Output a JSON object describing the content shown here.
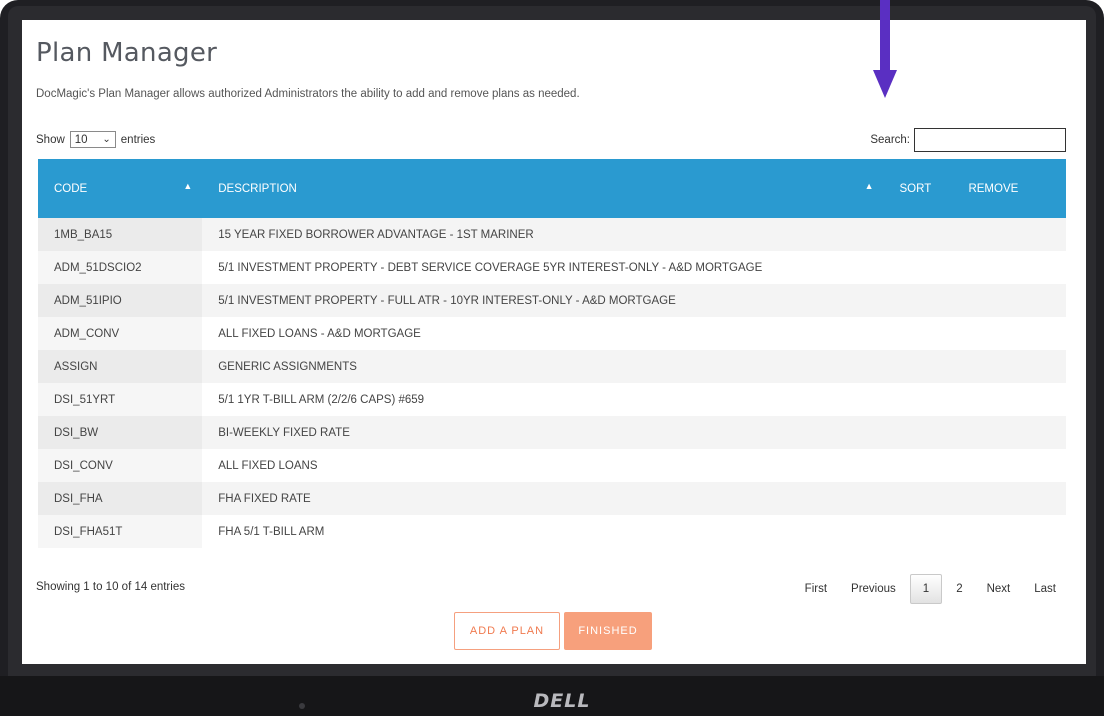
{
  "page": {
    "title": "Plan Manager",
    "description": "DocMagic's Plan Manager allows authorized Administrators the ability to add and remove plans as needed."
  },
  "length_menu": {
    "show_label": "Show",
    "selected": "10",
    "entries_label": "entries"
  },
  "search": {
    "label": "Search:",
    "value": ""
  },
  "table": {
    "columns": [
      "CODE",
      "DESCRIPTION",
      "SORT",
      "REMOVE"
    ],
    "rows": [
      {
        "code": "1MB_BA15",
        "description": "15 YEAR FIXED BORROWER ADVANTAGE - 1ST MARINER"
      },
      {
        "code": "ADM_51DSCIO2",
        "description": "5/1 INVESTMENT PROPERTY - DEBT SERVICE COVERAGE 5YR INTEREST-ONLY - A&D MORTGAGE"
      },
      {
        "code": "ADM_51IPIO",
        "description": "5/1 INVESTMENT PROPERTY - FULL ATR - 10YR INTEREST-ONLY - A&D MORTGAGE"
      },
      {
        "code": "ADM_CONV",
        "description": "ALL FIXED LOANS - A&D MORTGAGE"
      },
      {
        "code": "ASSIGN",
        "description": "GENERIC ASSIGNMENTS"
      },
      {
        "code": "DSI_51YRT",
        "description": "5/1 1YR T-BILL ARM (2/2/6 CAPS) #659"
      },
      {
        "code": "DSI_BW",
        "description": "BI-WEEKLY FIXED RATE"
      },
      {
        "code": "DSI_CONV",
        "description": "ALL FIXED LOANS"
      },
      {
        "code": "DSI_FHA",
        "description": "FHA FIXED RATE"
      },
      {
        "code": "DSI_FHA51T",
        "description": "FHA 5/1 T-BILL ARM"
      }
    ]
  },
  "info": "Showing 1 to 10 of 14 entries",
  "pagination": {
    "first": "First",
    "previous": "Previous",
    "pages": [
      "1",
      "2"
    ],
    "current": "1",
    "next": "Next",
    "last": "Last"
  },
  "actions": {
    "add_label": "ADD A PLAN",
    "finished_label": "FINISHED"
  },
  "device": {
    "brand": "DELL"
  },
  "colors": {
    "header_bg": "#2a9ad0",
    "accent": "#f07a4f",
    "arrow": "#5a2fc2"
  },
  "icons": {
    "sort_asc": "sort-asc-icon",
    "sort_both": "sort-both-icon",
    "select_chevron": "chevron-down-icon",
    "annotation_arrow": "arrow-down-icon"
  }
}
